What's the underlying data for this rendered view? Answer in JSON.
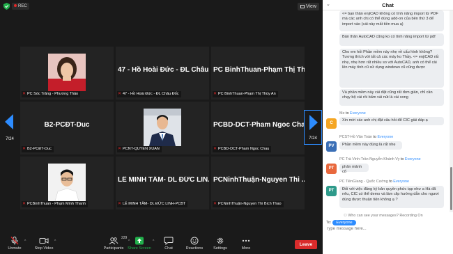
{
  "topbar": {
    "rec_label": "REC",
    "view_label": "View"
  },
  "pager": {
    "left_page": "7/24",
    "right_page": "7/24"
  },
  "tiles": [
    {
      "name": "",
      "label": "PC Sóc Trăng - Phương Thảo",
      "has_photo": true,
      "photo": "woman-red"
    },
    {
      "name": "47 - Hồ Hoài Đức - ĐL Châu ...",
      "label": "47 - Hồ Hoài Đức - ĐL Châu Đốc",
      "has_photo": false
    },
    {
      "name": "PC BinhThuan-Phạm Thị Th...",
      "label": "PC BinhThuan-Phạm Thị Thùy An",
      "has_photo": false
    },
    {
      "name": "B2-PCĐT-Duc",
      "label": "B2-PCĐT-Duc",
      "has_photo": false
    },
    {
      "name": "",
      "label": "PCNT-QUYEN XUAN",
      "has_photo": true,
      "photo": "man-suit"
    },
    {
      "name": "PCBD-DCT-Pham Ngoc Chau",
      "label": "PCBD-DCT-Pham Ngoc Chau",
      "has_photo": false
    },
    {
      "name": "",
      "label": "PCBinhThuan - Phạm Minh Thanh",
      "has_photo": true,
      "photo": "man-glasses"
    },
    {
      "name": "LÊ MINH TÂM- DL ĐỨC LIN...",
      "label": "LÊ MINH TÂM- DL ĐỨC LINH-PCBT",
      "has_photo": false
    },
    {
      "name": "PCNinhThuận-Nguyen Thi ...",
      "label": "PCNinhThuận-Nguyen Thi Bich Thao",
      "has_photo": false
    }
  ],
  "toolbar": {
    "unmute": "Unmute",
    "stop_video": "Stop Video",
    "participants": "Participants",
    "participants_count": "229",
    "share_screen": "Share Screen",
    "chat": "Chat",
    "reactions": "Reactions",
    "settings": "Settings",
    "more": "More",
    "leave": "Leave"
  },
  "chat": {
    "title": "Chat",
    "bubbles_top": [
      "<= bạn thân enjiCAD không có tính năng import từ PDF mà các anh chị có thể dùng add-on của bên thứ 3 để import vào (cái này mất tiền mua ạ)",
      "Bản thân AutoCAD cũng ko có tính năng import từ pdf",
      "Cho em hỏi Phần mềm này nhẹ về cấu hình không? Tương thích với tất cả các máy ko Thầy. <= enjiCAD rất nhẹ, nhẹ hơn rất nhiều so với AutoCAD, anh có thể cài lên máy tính cũ sử dụng windows cũ cũng được",
      "Và phần mềm này cài đặt cũng rất đơn giản, chỉ cần chạy bộ cài rồi bấm vài nút là cài xong"
    ],
    "messages": [
      {
        "sender": "Me",
        "to": "to",
        "recipient": "Everyone",
        "text": "Xin mời các anh chị đặt câu hỏi để CIC giải đáp ạ",
        "initials": "C",
        "avatar_color": "#f5a623"
      },
      {
        "sender": "PCST-Hồ Văn Toàn",
        "to": "to",
        "recipient": "Everyone",
        "text": "Phần mềm này đúng là rất nhẹ",
        "initials": "PV",
        "avatar_color": "#3b6fb6"
      },
      {
        "sender": "PC Trà Vinh-Trần Nguyễn Khánh Vy",
        "to": "to",
        "recipient": "Everyone",
        "text": "phân mảnh cổ",
        "initials": "PT",
        "avatar_color": "#e8683d"
      },
      {
        "sender": "PC TiềnGiang - Quốc Cường",
        "to": "to",
        "recipient": "Everyone",
        "text": "Đối với việc đăng ký bản quyền phức tạp như a Hà đã nêu, CIC có thể demo và làm clip hướng dẫn cho ngươi dùng được thuận tiện không ạ ?",
        "initials": "PT",
        "avatar_color": "#2e9a8a"
      }
    ],
    "who_can_see": "Who can see your messages? Recording On",
    "to_label": "To:",
    "to_value": "Everyone",
    "input_placeholder": "Type message here..."
  }
}
